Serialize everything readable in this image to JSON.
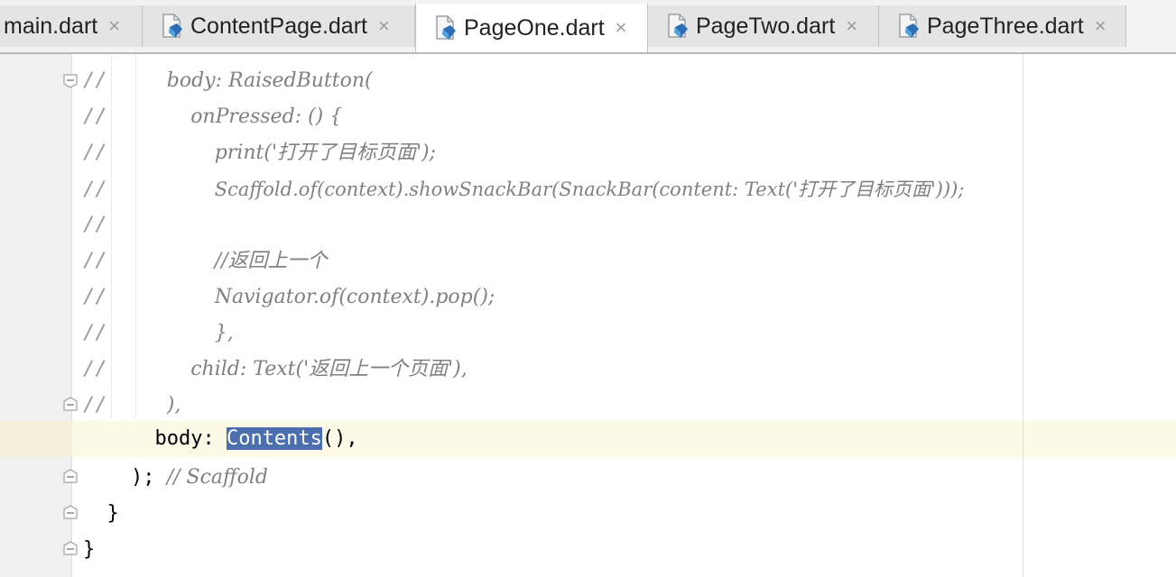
{
  "tabs": [
    {
      "label": "main.dart",
      "active": false,
      "has_icon": false
    },
    {
      "label": "ContentPage.dart",
      "active": false,
      "has_icon": true
    },
    {
      "label": "PageOne.dart",
      "active": true,
      "has_icon": true
    },
    {
      "label": "PageTwo.dart",
      "active": false,
      "has_icon": true
    },
    {
      "label": "PageThree.dart",
      "active": false,
      "has_icon": true
    }
  ],
  "tab_close_glyph": "×",
  "code_lines": [
    {
      "prefix": "//",
      "indent": "     ",
      "text": "body: RaisedButton(",
      "fold": "start"
    },
    {
      "prefix": "//",
      "indent": "       ",
      "text": "onPressed: () {",
      "fold": ""
    },
    {
      "prefix": "//",
      "indent": "         ",
      "text": "print('打开了目标页面');",
      "fold": ""
    },
    {
      "prefix": "//",
      "indent": "         ",
      "text": "Scaffold.of(context).showSnackBar(SnackBar(content: Text('打开了目标页面')));",
      "fold": ""
    },
    {
      "prefix": "//",
      "indent": "",
      "text": "",
      "fold": ""
    },
    {
      "prefix": "//",
      "indent": "         ",
      "text": "//返回上一个",
      "fold": ""
    },
    {
      "prefix": "//",
      "indent": "         ",
      "text": "Navigator.of(context).pop();",
      "fold": ""
    },
    {
      "prefix": "//",
      "indent": "         ",
      "text": "},",
      "fold": ""
    },
    {
      "prefix": "//",
      "indent": "       ",
      "text": "child: Text('返回上一个页面'),",
      "fold": ""
    },
    {
      "prefix": "//",
      "indent": "     ",
      "text": "),",
      "fold": "end"
    }
  ],
  "current_line": {
    "before": "      body: ",
    "selected": "Contents",
    "after": "(),"
  },
  "scaffold_line": {
    "code": "    ); ",
    "comment": "// Scaffold"
  },
  "close_brace_inner": "  }",
  "close_brace_outer": "}",
  "colors": {
    "selection": "#4b6eaf",
    "comment": "#808080",
    "current_line": "#fcf9e6",
    "gutter": "#f0f0f0"
  }
}
